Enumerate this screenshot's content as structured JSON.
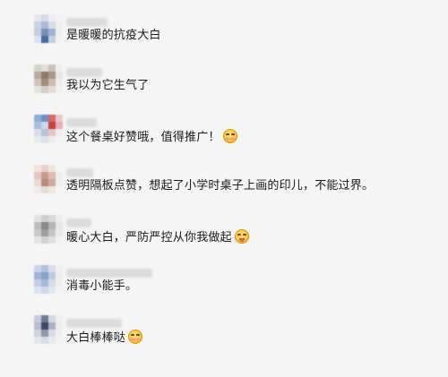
{
  "comments": [
    {
      "text": "是暖暖的抗疫大白",
      "emoji": null
    },
    {
      "text": "我以为它生气了",
      "emoji": null
    },
    {
      "text": "这个餐桌好赞哦，值得推广！",
      "emoji": "smiling-face-icon"
    },
    {
      "text": "透明隔板点赞，想起了小学时桌子上画的印儿，不能过界。",
      "emoji": null
    },
    {
      "text": "暖心大白，严防严控从你我做起",
      "emoji": "tongue-out-face-icon"
    },
    {
      "text": "消毒小能手。",
      "emoji": null
    },
    {
      "text": "大白棒棒哒",
      "emoji": "grinning-face-icon"
    }
  ],
  "colors": {
    "background": "#f5f5f5",
    "text": "#1a1a1a"
  }
}
